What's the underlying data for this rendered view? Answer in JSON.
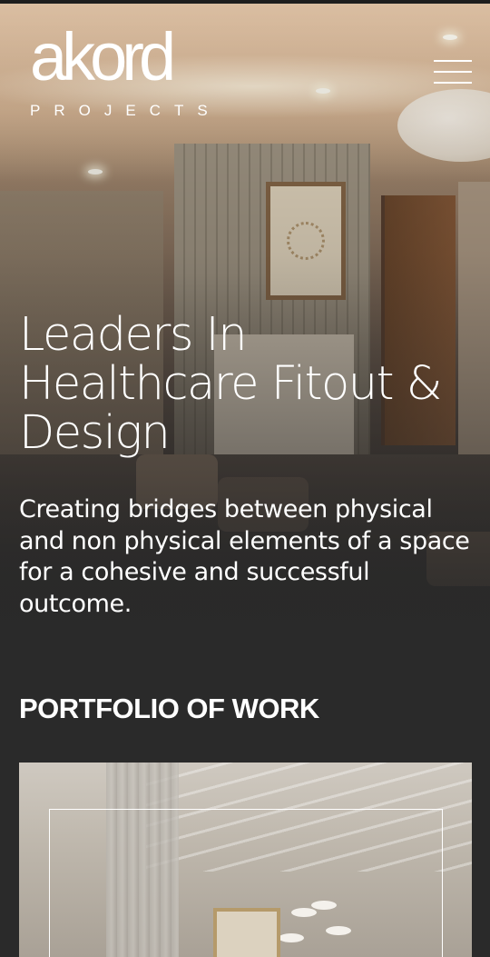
{
  "brand": {
    "logo_word": "akord",
    "logo_sub": "PROJECTS"
  },
  "nav": {
    "menu_icon": "hamburger-menu-icon"
  },
  "hero": {
    "headline": "Leaders In Healthcare Fitout & Design",
    "tagline": "Creating bridges between physical and non physical elements of a space for a cohesive and successful outcome."
  },
  "portfolio": {
    "title": "PORTFOLIO OF WORK"
  },
  "colors": {
    "background": "#2a2a2a",
    "text": "#ffffff"
  }
}
